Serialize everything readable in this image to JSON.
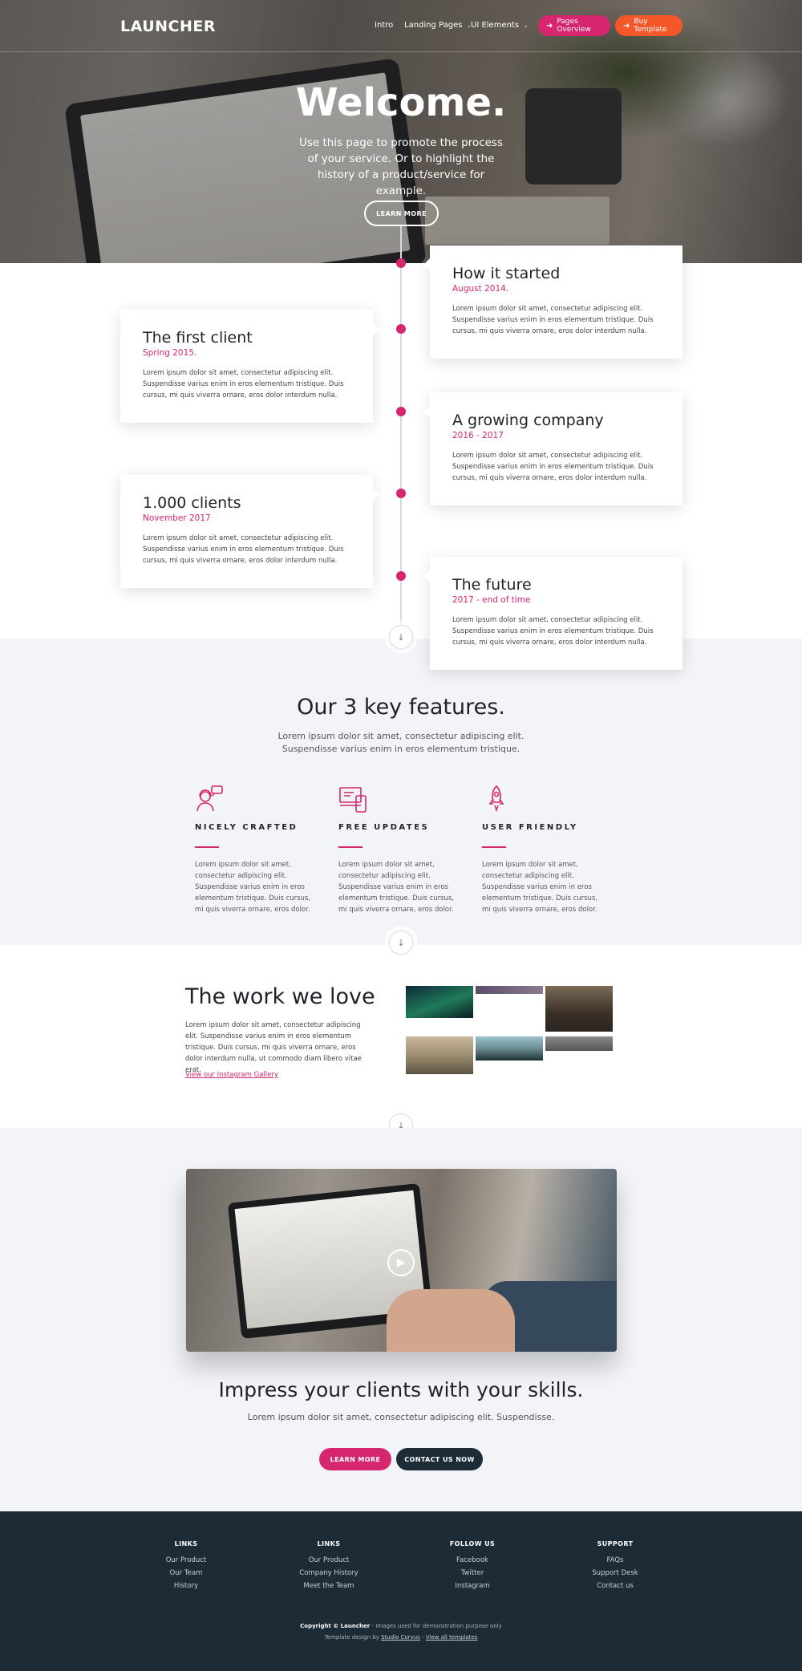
{
  "colors": {
    "accent": "#d6266f",
    "orange": "#f4582a",
    "dark": "#1d2b37",
    "light_bg": "#f3f4f8"
  },
  "nav": {
    "logo": "LAUNCHER",
    "intro": "Intro",
    "landing_pages": "Landing Pages",
    "ui_elements": "UI Elements",
    "pages_overview": "Pages Overview",
    "buy_template": "Buy Template"
  },
  "hero": {
    "title": "Welcome.",
    "subtitle": "Use this page to promote the process of your service. Or to highlight the history of a product/service for example.",
    "button": "LEARN MORE"
  },
  "timeline": [
    {
      "title": "How it started",
      "date": "August 2014.",
      "text": "Lorem ipsum dolor sit amet, consectetur adipiscing elit. Suspendisse varius enim in eros elementum tristique. Duis cursus, mi quis viverra ornare, eros dolor interdum nulla."
    },
    {
      "title": "The first client",
      "date": "Spring 2015.",
      "text": "Lorem ipsum dolor sit amet, consectetur adipiscing elit. Suspendisse varius enim in eros elementum tristique. Duis cursus, mi quis viverra ornare, eros dolor interdum nulla."
    },
    {
      "title": "A growing company",
      "date": "2016 - 2017",
      "text": "Lorem ipsum dolor sit amet, consectetur adipiscing elit. Suspendisse varius enim in eros elementum tristique. Duis cursus, mi quis viverra ornare, eros dolor interdum nulla."
    },
    {
      "title": "1.000 clients",
      "date": "November 2017",
      "text": "Lorem ipsum dolor sit amet, consectetur adipiscing elit. Suspendisse varius enim in eros elementum tristique. Duis cursus, mi quis viverra ornare, eros dolor interdum nulla."
    },
    {
      "title": "The future",
      "date": "2017 - end of time",
      "text": "Lorem ipsum dolor sit amet, consectetur adipiscing elit. Suspendisse varius enim in eros elementum tristique. Duis cursus, mi quis viverra ornare, eros dolor interdum nulla."
    }
  ],
  "features": {
    "title": "Our 3 key features.",
    "subtitle": "Lorem ipsum dolor sit amet, consectetur adipiscing elit. Suspendisse varius enim in eros elementum tristique.",
    "items": [
      {
        "icon": "support-agent-icon",
        "title": "NICELY CRAFTED",
        "text": "Lorem ipsum dolor sit amet, consectetur adipiscing elit. Suspendisse varius enim in eros elementum tristique. Duis cursus, mi quis viverra ornare, eros dolor."
      },
      {
        "icon": "devices-icon",
        "title": "FREE UPDATES",
        "text": "Lorem ipsum dolor sit amet, consectetur adipiscing elit. Suspendisse varius enim in eros elementum tristique. Duis cursus, mi quis viverra ornare, eros dolor."
      },
      {
        "icon": "rocket-icon",
        "title": "USER FRIENDLY",
        "text": "Lorem ipsum dolor sit amet, consectetur adipiscing elit. Suspendisse varius enim in eros elementum tristique. Duis cursus, mi quis viverra ornare, eros dolor."
      }
    ]
  },
  "work": {
    "title": "The work we love",
    "text": "Lorem ipsum dolor sit amet, consectetur adipiscing elit. Suspendisse varius enim in eros elementum tristique. Duis cursus, mi quis viverra ornare, eros dolor interdum nulla, ut commodo diam libero vitae erat.",
    "link": "View our Instagram Gallery"
  },
  "cta": {
    "title": "Impress your clients with your skills.",
    "subtitle": "Lorem ipsum dolor sit amet, consectetur adipiscing elit. Suspendisse.",
    "learn_more": "LEARN MORE",
    "contact": "CONTACT US NOW"
  },
  "footer": {
    "columns": [
      {
        "title": "LINKS",
        "items": [
          "Our Product",
          "Our Team",
          "History"
        ]
      },
      {
        "title": "LINKS",
        "items": [
          "Our Product",
          "Company History",
          "Meet the Team"
        ]
      },
      {
        "title": "FOLLOW US",
        "items": [
          "Facebook",
          "Twitter",
          "Instagram"
        ]
      },
      {
        "title": "SUPPORT",
        "items": [
          "FAQs",
          "Support Desk",
          "Contact us"
        ]
      }
    ],
    "copyright_bold": "Copyright © Launcher",
    "copyright_rest": " - Images used for demonstration purpose only",
    "design_prefix": "Template design by ",
    "design_link": "Studio Corvus",
    "design_sep": " - ",
    "view_all": "View all templates"
  }
}
